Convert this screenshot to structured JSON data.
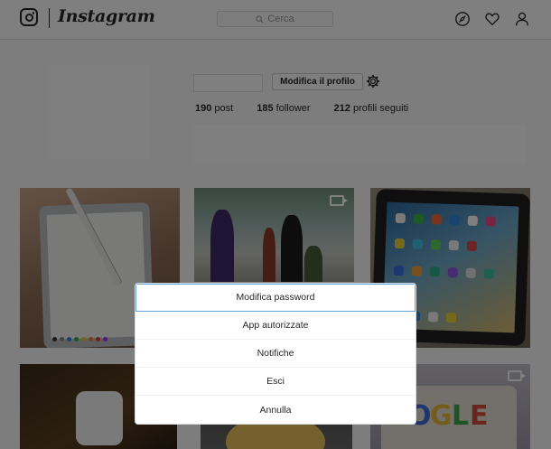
{
  "header": {
    "brand": "Instagram",
    "search_placeholder": "Cerca",
    "icons": [
      "instagram-logo-icon",
      "search-icon",
      "compass-icon",
      "heart-icon",
      "user-icon"
    ]
  },
  "profile": {
    "edit_label": "Modifica il profilo",
    "settings_icon": "gear-icon",
    "stats": [
      {
        "count": "190",
        "label": "post"
      },
      {
        "count": "185",
        "label": "follower"
      },
      {
        "count": "212",
        "label": "profili seguiti"
      }
    ]
  },
  "dialog": {
    "items": [
      "Modifica password",
      "App autorizzate",
      "Notifiche",
      "Esci",
      "Annulla"
    ]
  },
  "colors": {
    "focus_outline": "#62a5dc",
    "overlay": "rgba(0,0,0,0.5)"
  }
}
